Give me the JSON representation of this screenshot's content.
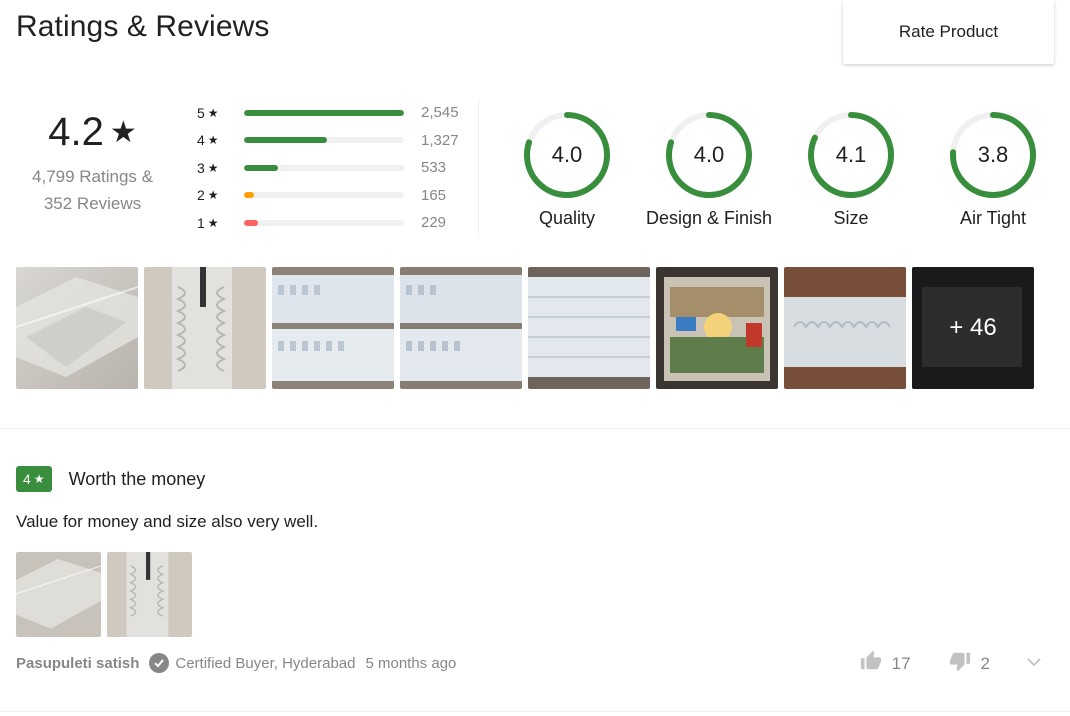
{
  "header": {
    "title": "Ratings & Reviews",
    "rate_button": "Rate Product"
  },
  "summary": {
    "average": "4.2",
    "star_glyph": "★",
    "ratings_text": "4,799 Ratings &",
    "reviews_text": "352 Reviews"
  },
  "distribution": [
    {
      "stars": "5",
      "count": "2,545",
      "fraction": 1.0,
      "color": "#388e3c"
    },
    {
      "stars": "4",
      "count": "1,327",
      "fraction": 0.52,
      "color": "#388e3c"
    },
    {
      "stars": "3",
      "count": "533",
      "fraction": 0.21,
      "color": "#388e3c"
    },
    {
      "stars": "2",
      "count": "165",
      "fraction": 0.065,
      "color": "#ff9f00"
    },
    {
      "stars": "1",
      "count": "229",
      "fraction": 0.09,
      "color": "#ff6161"
    }
  ],
  "aspects": [
    {
      "name": "Quality",
      "value": "4.0",
      "fraction": 0.8
    },
    {
      "name": "Design & Finish",
      "value": "4.0",
      "fraction": 0.8
    },
    {
      "name": "Size",
      "value": "4.1",
      "fraction": 0.82
    },
    {
      "name": "Air Tight",
      "value": "3.8",
      "fraction": 0.76
    }
  ],
  "photos": {
    "more_label": "+ 46"
  },
  "review": {
    "rating": "4",
    "title": "Worth the money",
    "text": "Value for money and size also very well.",
    "author": "Pasupuleti satish",
    "certified": "Certified Buyer, Hyderabad",
    "time": "5 months ago",
    "likes": "17",
    "dislikes": "2"
  },
  "colors": {
    "accent_green": "#388e3c",
    "muted_text": "#878787",
    "orange": "#ff9f00",
    "red": "#ff6161"
  }
}
